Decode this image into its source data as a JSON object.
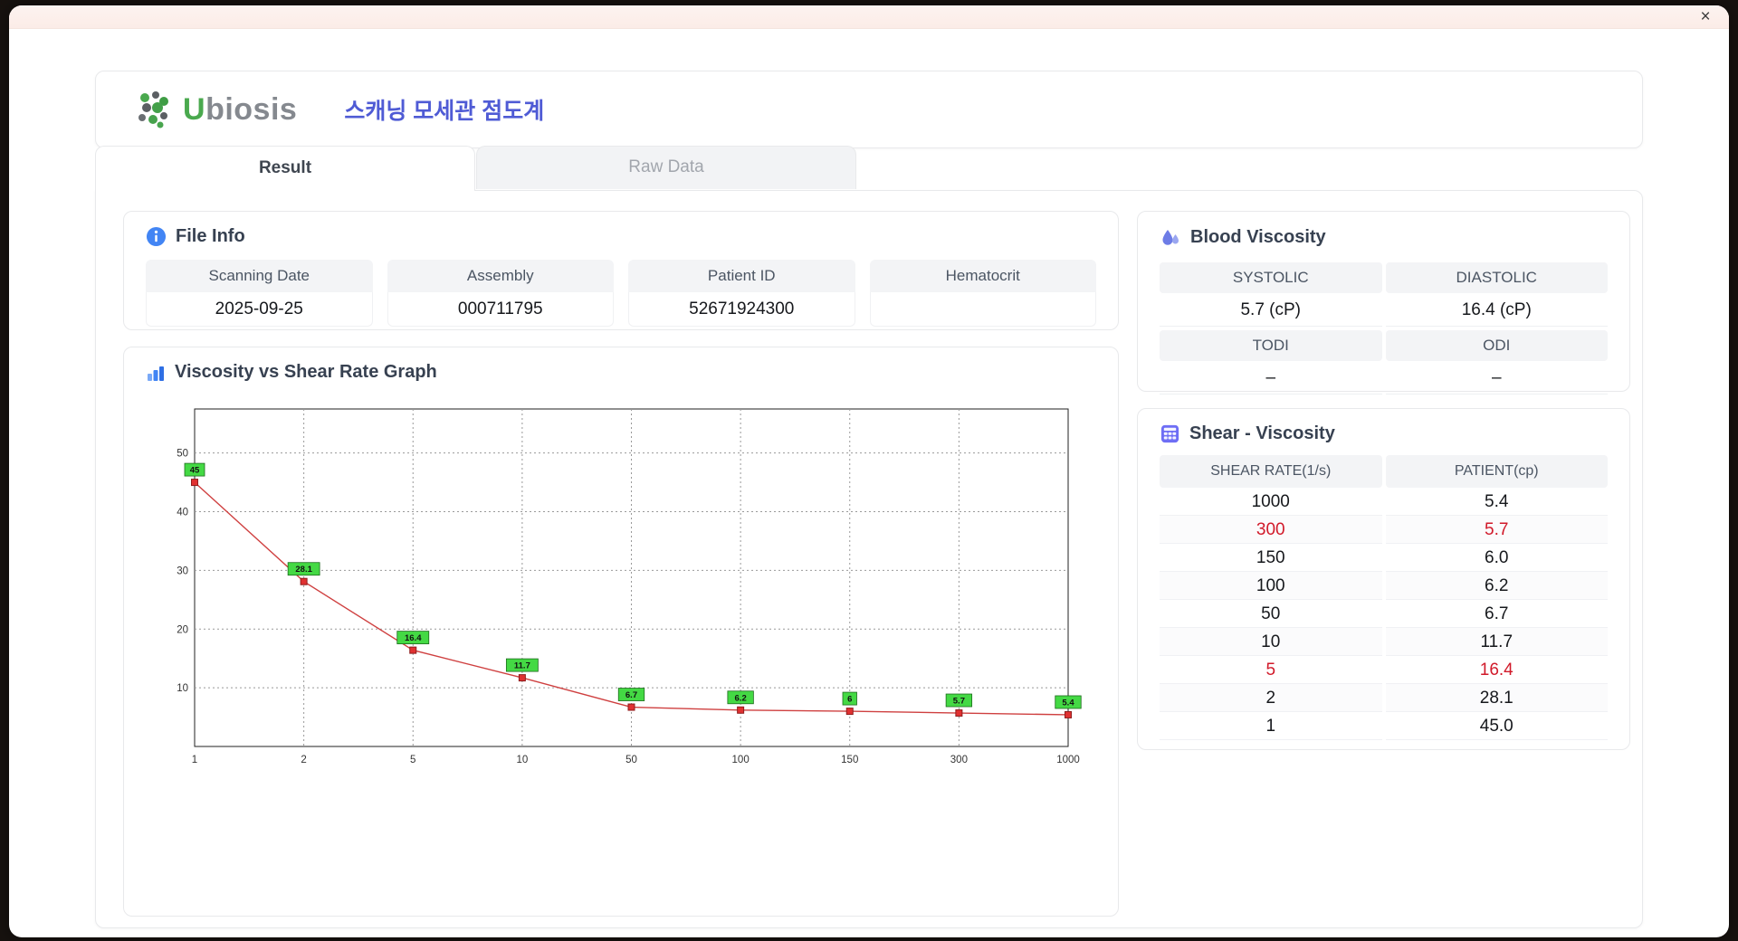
{
  "window": {
    "close_label": "×"
  },
  "header": {
    "logo_accent": "U",
    "logo_rest": "biosis",
    "app_title": "스캐닝 모세관 점도계"
  },
  "tabs": [
    {
      "label": "Result",
      "active": true
    },
    {
      "label": "Raw Data",
      "active": false
    }
  ],
  "file_info": {
    "title": "File Info",
    "fields": [
      {
        "label": "Scanning Date",
        "value": "2025-09-25"
      },
      {
        "label": "Assembly",
        "value": "000711795"
      },
      {
        "label": "Patient ID",
        "value": "52671924300"
      },
      {
        "label": "Hematocrit",
        "value": ""
      }
    ]
  },
  "blood_viscosity": {
    "title": "Blood Viscosity",
    "rows": [
      {
        "headers": [
          "SYSTOLIC",
          "DIASTOLIC"
        ],
        "values": [
          "5.7 (cP)",
          "16.4 (cP)"
        ]
      },
      {
        "headers": [
          "TODI",
          "ODI"
        ],
        "values": [
          "–",
          "–"
        ]
      }
    ]
  },
  "shear_viscosity": {
    "title": "Shear - Viscosity",
    "columns": [
      "SHEAR RATE(1/s)",
      "PATIENT(cp)"
    ],
    "rows": [
      {
        "rate": "1000",
        "value": "5.4",
        "highlight": false
      },
      {
        "rate": "300",
        "value": "5.7",
        "highlight": true
      },
      {
        "rate": "150",
        "value": "6.0",
        "highlight": false
      },
      {
        "rate": "100",
        "value": "6.2",
        "highlight": false
      },
      {
        "rate": "50",
        "value": "6.7",
        "highlight": false
      },
      {
        "rate": "10",
        "value": "11.7",
        "highlight": false
      },
      {
        "rate": "5",
        "value": "16.4",
        "highlight": true
      },
      {
        "rate": "2",
        "value": "28.1",
        "highlight": false
      },
      {
        "rate": "1",
        "value": "45.0",
        "highlight": false
      }
    ]
  },
  "graph": {
    "title": "Viscosity vs Shear Rate Graph"
  },
  "chart_data": {
    "type": "line",
    "title": "Viscosity vs Shear Rate Graph",
    "x_categories": [
      "1",
      "2",
      "5",
      "10",
      "50",
      "100",
      "150",
      "300",
      "1000"
    ],
    "values": [
      45,
      28.1,
      16.4,
      11.7,
      6.7,
      6.2,
      6,
      5.7,
      5.4
    ],
    "point_labels": [
      "45",
      "28.1",
      "16.4",
      "11.7",
      "6.7",
      "6.2",
      "6",
      "5.7",
      "5.4"
    ],
    "y_ticks": [
      10,
      20,
      30,
      40,
      50
    ],
    "ylim": [
      0,
      57.5
    ],
    "grid": true,
    "xlabel": "",
    "ylabel": "",
    "line_color": "#cf4040",
    "marker_fill": "#e03131",
    "marker_stroke": "#8f1d1d",
    "label_bg": "#44d944",
    "label_border": "#1d6b1d"
  }
}
